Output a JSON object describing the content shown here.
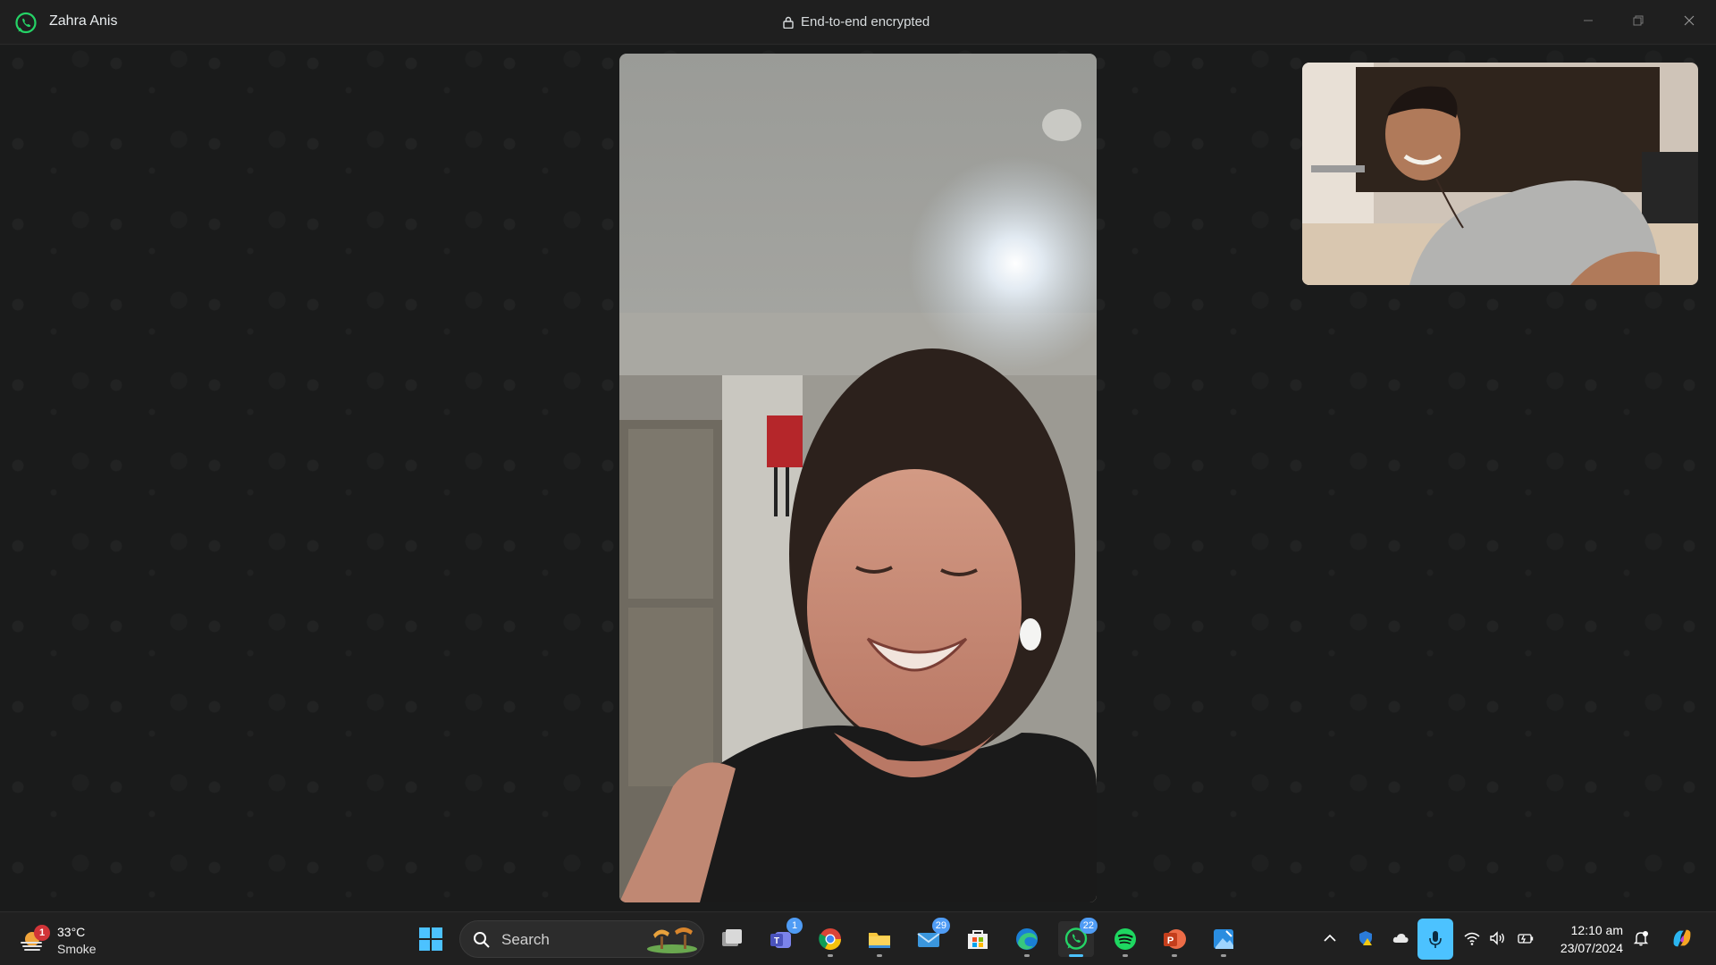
{
  "window": {
    "contact_name": "Zahra Anis",
    "encryption_label": "End-to-end encrypted"
  },
  "colors": {
    "whatsapp_green": "#25d366",
    "accent_blue": "#4cc2ff",
    "badge_blue": "#4f9cf5",
    "alert_red": "#d13438"
  },
  "taskbar": {
    "weather": {
      "badge": "1",
      "temperature": "33°C",
      "condition": "Smoke"
    },
    "search": {
      "label": "Search"
    },
    "badges": {
      "teams": "1",
      "chrome": "",
      "mail": "29",
      "whatsapp": "22"
    },
    "clock": {
      "time": "12:10 am",
      "date": "23/07/2024"
    }
  }
}
